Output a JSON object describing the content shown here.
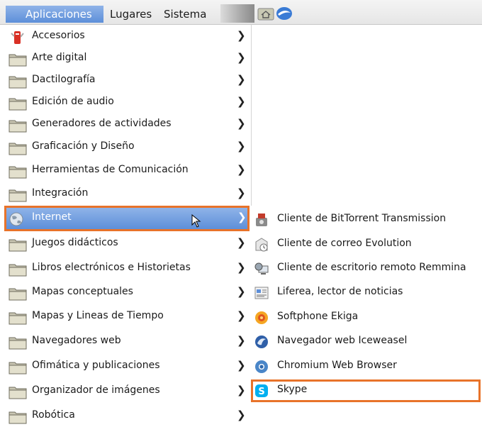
{
  "panel": {
    "applications": "Aplicaciones",
    "places": "Lugares",
    "system": "Sistema"
  },
  "menu": {
    "items": [
      {
        "label": "Accesorios",
        "icon": "accessories-icon"
      },
      {
        "label": "Arte digital",
        "icon": "folder-icon"
      },
      {
        "label": "Dactilografía",
        "icon": "folder-icon"
      },
      {
        "label": "Edición de audio",
        "icon": "folder-icon"
      },
      {
        "label": "Generadores de actividades",
        "icon": "folder-icon"
      },
      {
        "label": "Graficación y Diseño",
        "icon": "folder-icon"
      },
      {
        "label": "Herramientas de Comunicación",
        "icon": "folder-icon"
      },
      {
        "label": "Integración",
        "icon": "folder-icon"
      },
      {
        "label": "Internet",
        "icon": "globe-icon",
        "active": true
      },
      {
        "label": "Juegos didácticos",
        "icon": "folder-icon"
      },
      {
        "label": "Libros electrónicos e Historietas",
        "icon": "folder-icon"
      },
      {
        "label": "Mapas conceptuales",
        "icon": "folder-icon"
      },
      {
        "label": "Mapas y Lineas de Tiempo",
        "icon": "folder-icon"
      },
      {
        "label": "Navegadores web",
        "icon": "folder-icon"
      },
      {
        "label": "Ofimática y publicaciones",
        "icon": "folder-icon"
      },
      {
        "label": "Organizador de imágenes",
        "icon": "folder-icon"
      },
      {
        "label": "Robótica",
        "icon": "folder-icon"
      }
    ],
    "chevron": "❯"
  },
  "submenu": {
    "items": [
      {
        "label": "Cliente de BitTorrent Transmission",
        "icon": "transmission-icon"
      },
      {
        "label": "Cliente de correo Evolution",
        "icon": "evolution-icon"
      },
      {
        "label": "Cliente de escritorio remoto Remmina",
        "icon": "remmina-icon"
      },
      {
        "label": "Liferea, lector de noticias",
        "icon": "liferea-icon"
      },
      {
        "label": "Softphone Ekiga",
        "icon": "ekiga-icon"
      },
      {
        "label": "Navegador web Iceweasel",
        "icon": "iceweasel-icon"
      },
      {
        "label": "Chromium Web Browser",
        "icon": "chromium-icon"
      },
      {
        "label": "Skype",
        "icon": "skype-icon",
        "highlighted": true
      }
    ]
  },
  "colors": {
    "selection": "#5d8fd9",
    "highlight_outline": "#e8732a"
  }
}
